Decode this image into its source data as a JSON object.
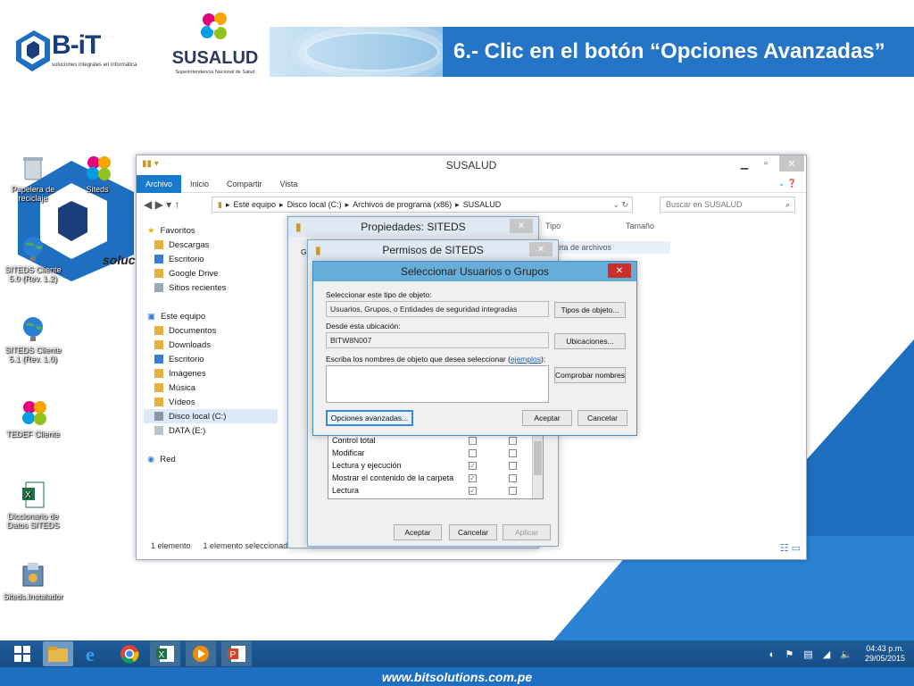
{
  "slide": {
    "title": "6.- Clic en el botón “Opciones Avanzadas”",
    "footer_url": "www.bitsolutions.com.pe",
    "logo_bit": {
      "name": "B-iT",
      "tagline": "soluciones integrales en informática"
    },
    "logo_susalud": {
      "name": "SUSALUD",
      "tagline": "Superintendencia Nacional de Salud"
    }
  },
  "desktop": {
    "icons": [
      {
        "label": "Papelera de reciclaje",
        "icon": "recycle-bin-icon"
      },
      {
        "label": "Siteds",
        "icon": "siteds-icon"
      },
      {
        "label": "SITEDS Cliente 5.0 (Rev. 1.2)",
        "icon": "globe-icon"
      },
      {
        "label": "SITEDS Cliente 5.1 (Rev. 1.0)",
        "icon": "globe-icon"
      },
      {
        "label": "TEDEF Cliente",
        "icon": "tedef-icon"
      },
      {
        "label": "Diccionario de Datos SITEDS",
        "icon": "excel-icon"
      },
      {
        "label": "Siteds.Instalador",
        "icon": "installer-icon"
      }
    ],
    "watermark_text": "soluc"
  },
  "explorer": {
    "title": "SUSALUD",
    "ribbon_tabs": [
      "Archivo",
      "Inicio",
      "Compartir",
      "Vista"
    ],
    "address_parts": [
      "Este equipo",
      "Disco local (C:)",
      "Archivos de programa (x86)",
      "SUSALUD"
    ],
    "search_placeholder": "Buscar en SUSALUD",
    "columns": [
      "Tipo",
      "Tamaño"
    ],
    "first_row_type": "peta de archivos",
    "nav_favorites": {
      "header": "Favoritos",
      "items": [
        "Descargas",
        "Escritorio",
        "Google Drive",
        "Sitios recientes"
      ]
    },
    "nav_pc": {
      "header": "Este equipo",
      "items": [
        "Documentos",
        "Downloads",
        "Escritorio",
        "Imágenes",
        "Música",
        "Vídeos",
        "Disco local (C:)",
        "DATA (E:)"
      ]
    },
    "nav_network": "Red",
    "status_count": "1 elemento",
    "status_selected": "1 elemento seleccionado"
  },
  "properties_dialog": {
    "title": "Propiedades: SITEDS",
    "tab_stub": "G"
  },
  "permissions_dialog": {
    "title": "Permisos de SITEDS",
    "permissions": [
      {
        "name": "Control total",
        "allow": false,
        "deny": false
      },
      {
        "name": "Modificar",
        "allow": false,
        "deny": false
      },
      {
        "name": "Lectura y ejecución",
        "allow": true,
        "deny": false
      },
      {
        "name": "Mostrar el contenido de la carpeta",
        "allow": true,
        "deny": false
      },
      {
        "name": "Lectura",
        "allow": true,
        "deny": false
      }
    ],
    "buttons": {
      "ok": "Aceptar",
      "cancel": "Cancelar",
      "apply": "Aplicar"
    }
  },
  "select_dialog": {
    "title": "Seleccionar Usuarios o Grupos",
    "object_type_label": "Seleccionar este tipo de objeto:",
    "object_type_value": "Usuarios, Grupos, o Entidades de seguridad integradas",
    "object_types_button": "Tipos de objeto...",
    "location_label": "Desde esta ubicación:",
    "location_value": "BITW8N007",
    "locations_button": "Ubicaciones...",
    "names_label": "Escriba los nombres de objeto que desea seleccionar (",
    "names_link": "ejemplos",
    "names_label_end": "):",
    "check_names_button": "Comprobar nombres",
    "advanced_button": "Opciones avanzadas...",
    "ok": "Aceptar",
    "cancel": "Cancelar"
  },
  "taskbar": {
    "apps": [
      "windows-start-icon",
      "file-explorer-icon",
      "internet-explorer-icon",
      "chrome-icon",
      "excel-icon",
      "media-player-icon",
      "powerpoint-icon"
    ],
    "time": "04:43 p.m.",
    "date": "29/05/2015"
  },
  "colors": {
    "accent": "#2475c5",
    "title_bar_dialog": "#67add9",
    "close_red": "#c9302c"
  }
}
